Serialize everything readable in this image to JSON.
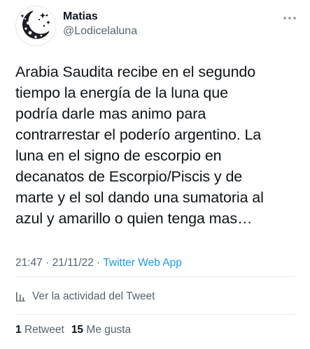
{
  "author": {
    "display_name": "Matias",
    "handle": "@Lodicelaluna",
    "avatar_icon": "moon-stars-avatar-icon"
  },
  "menu_icon": "more-options-icon",
  "tweet": {
    "lines": [
      "Arabia Saudita recibe en el segundo",
      "tiempo la energía de la luna que",
      "podría darle mas animo para",
      "contrarrestar el poderío argentino. La",
      "luna en el signo de escorpio en",
      "decanatos de Escorpio/Piscis y de",
      "marte y el sol dando una sumatoria al",
      "azul y amarillo o quien tenga mas…"
    ]
  },
  "meta": {
    "time": "21:47",
    "separator": "·",
    "date": "21/11/22",
    "separator2": "·",
    "source": "Twitter Web App"
  },
  "analytics": {
    "icon": "bar-chart-icon",
    "label": "Ver la actividad del Tweet"
  },
  "stats": {
    "retweets_count": "1",
    "retweets_label": "Retweet",
    "likes_count": "15",
    "likes_label": "Me gusta"
  },
  "colors": {
    "text": "#0f1419",
    "secondary": "#536471",
    "link": "#1d9bf0",
    "divider": "#e6ecf0"
  }
}
